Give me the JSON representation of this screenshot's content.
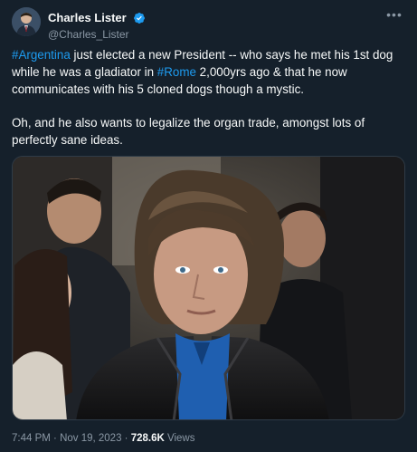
{
  "author": {
    "display_name": "Charles Lister",
    "handle": "@Charles_Lister",
    "verified_icon": "verified-badge-icon",
    "avatar_icon": "avatar-portrait"
  },
  "tweet": {
    "p1": {
      "hashtag1": "#Argentina",
      "text1": " just elected a new President -- who says he met his 1st dog while he was a gladiator in ",
      "hashtag2": "#Rome",
      "text2": " 2,000yrs ago & that he now communicates with his 5 cloned dogs though a mystic."
    },
    "p2": "Oh, and he also wants to legalize the organ trade, amongst lots of perfectly sane ideas."
  },
  "media": {
    "type": "photo",
    "subject": "portrait photo of a man in a leather jacket in a crowd"
  },
  "footer": {
    "time": "7:44 PM",
    "sep1": " · ",
    "date": "Nov 19, 2023",
    "sep2": " · ",
    "views": "728.6K",
    "views_label": " Views"
  },
  "colors": {
    "background": "#15202b",
    "accent": "#1d9bf0",
    "secondary": "#8b98a5"
  }
}
